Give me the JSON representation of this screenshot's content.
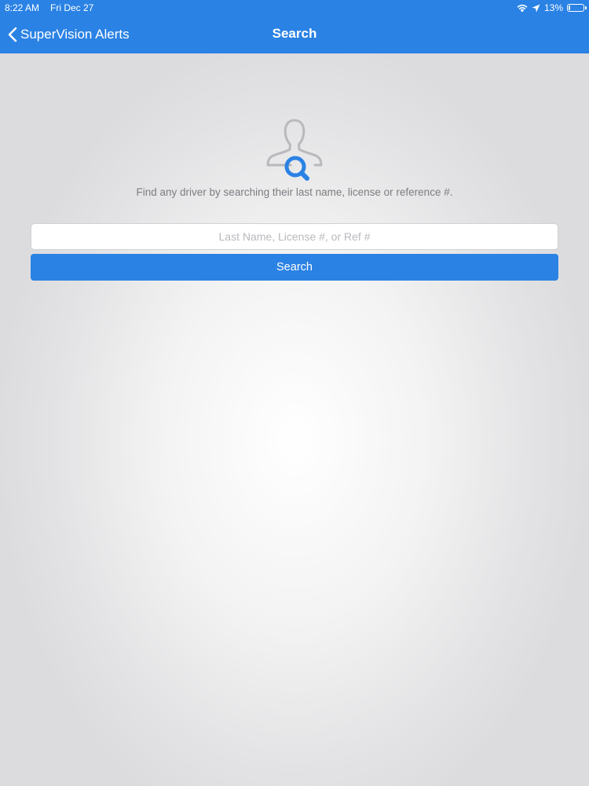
{
  "status_bar": {
    "time": "8:22 AM",
    "date": "Fri Dec 27",
    "battery_percent": "13%",
    "battery_level": 0.13,
    "icons": [
      "wifi-icon",
      "location-arrow-icon",
      "battery-icon"
    ]
  },
  "nav_bar": {
    "back_label": "SuperVision Alerts",
    "title": "Search",
    "background_color": "#2a82e4"
  },
  "main": {
    "hero_icon": "person-search-icon",
    "hint_text": "Find any driver by searching their last name, license or reference #.",
    "search_input": {
      "value": "",
      "placeholder": "Last Name, License #, or Ref #"
    },
    "search_button_label": "Search",
    "accent_color": "#2a82e4"
  }
}
